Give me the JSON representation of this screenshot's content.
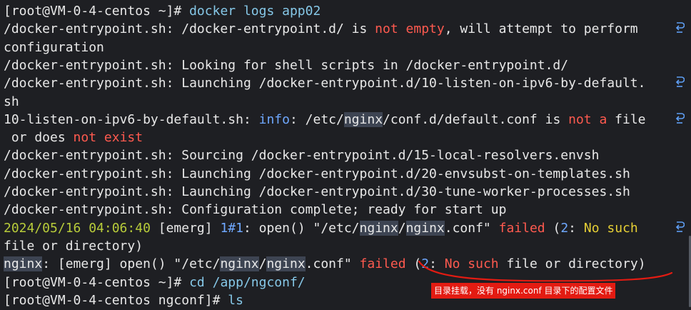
{
  "colors": {
    "background": "#1e1f23",
    "default": "#e8e8e8",
    "prompt_path": "#86c8e8",
    "command": "#6fa8ff",
    "error": "#ff5a4f",
    "timestamp": "#b8cc3a",
    "highlight_word": "#e6cf35",
    "annotation": "#e31b12"
  },
  "terminal": {
    "lines": [
      {
        "wrap": false,
        "segments": [
          {
            "t": "[root@VM-0-4-centos ~]# ",
            "c": "default"
          },
          {
            "t": "docker logs app02",
            "c": "cyan"
          }
        ]
      },
      {
        "wrap": true,
        "segments": [
          {
            "t": "/docker-entrypoint.sh: /docker-entrypoint.d/ is ",
            "c": "default"
          },
          {
            "t": "not empty",
            "c": "red"
          },
          {
            "t": ", will attempt to perform",
            "c": "default"
          }
        ]
      },
      {
        "wrap": false,
        "segments": [
          {
            "t": "configuration",
            "c": "default"
          }
        ]
      },
      {
        "wrap": false,
        "segments": [
          {
            "t": "/docker-entrypoint.sh: Looking for shell scripts in /docker-entrypoint.d/",
            "c": "default"
          }
        ]
      },
      {
        "wrap": true,
        "segments": [
          {
            "t": "/docker-entrypoint.sh: Launching /docker-entrypoint.d/10-listen-on-ipv6-by-default.",
            "c": "default"
          }
        ]
      },
      {
        "wrap": false,
        "segments": [
          {
            "t": "sh",
            "c": "default"
          }
        ]
      },
      {
        "wrap": true,
        "segments": [
          {
            "t": "10-listen-on-ipv6-by-default.sh: ",
            "c": "default"
          },
          {
            "t": "info",
            "c": "blue"
          },
          {
            "t": ": /etc/",
            "c": "default"
          },
          {
            "t": "nginx",
            "c": "default",
            "hl": true
          },
          {
            "t": "/conf.d/default.conf is ",
            "c": "default"
          },
          {
            "t": "not a",
            "c": "red"
          },
          {
            "t": " file",
            "c": "default"
          }
        ]
      },
      {
        "wrap": false,
        "segments": [
          {
            "t": " or does ",
            "c": "default"
          },
          {
            "t": "not exist",
            "c": "red"
          }
        ]
      },
      {
        "wrap": false,
        "segments": [
          {
            "t": "/docker-entrypoint.sh: Sourcing /docker-entrypoint.d/15-local-resolvers.envsh",
            "c": "default"
          }
        ]
      },
      {
        "wrap": false,
        "segments": [
          {
            "t": "/docker-entrypoint.sh: Launching /docker-entrypoint.d/20-envsubst-on-templates.sh",
            "c": "default"
          }
        ]
      },
      {
        "wrap": false,
        "segments": [
          {
            "t": "/docker-entrypoint.sh: Launching /docker-entrypoint.d/30-tune-worker-processes.sh",
            "c": "default"
          }
        ]
      },
      {
        "wrap": false,
        "segments": [
          {
            "t": "/docker-entrypoint.sh: Configuration complete; ready for start up",
            "c": "default"
          }
        ]
      },
      {
        "wrap": true,
        "segments": [
          {
            "t": "2024/05/16 04:06:40 ",
            "c": "green"
          },
          {
            "t": "[emerg] ",
            "c": "default"
          },
          {
            "t": "1#1",
            "c": "blue"
          },
          {
            "t": ": open() \"/etc/",
            "c": "default"
          },
          {
            "t": "nginx",
            "c": "default",
            "hl": true
          },
          {
            "t": "/",
            "c": "default"
          },
          {
            "t": "nginx",
            "c": "default",
            "hl": true
          },
          {
            "t": ".conf\" ",
            "c": "default"
          },
          {
            "t": "failed",
            "c": "red"
          },
          {
            "t": " (",
            "c": "default"
          },
          {
            "t": "2",
            "c": "blue"
          },
          {
            "t": ": ",
            "c": "default"
          },
          {
            "t": "No such",
            "c": "yellow"
          }
        ]
      },
      {
        "wrap": false,
        "segments": [
          {
            "t": "file or directory)",
            "c": "default"
          }
        ]
      },
      {
        "wrap": false,
        "segments": [
          {
            "t": "nginx",
            "c": "default",
            "hl": true
          },
          {
            "t": ": [emerg] open() \"/etc/",
            "c": "default"
          },
          {
            "t": "nginx",
            "c": "default",
            "hl": true
          },
          {
            "t": "/",
            "c": "default"
          },
          {
            "t": "nginx",
            "c": "default",
            "hl": true
          },
          {
            "t": ".conf\" ",
            "c": "default"
          },
          {
            "t": "failed",
            "c": "red"
          },
          {
            "t": " (",
            "c": "default"
          },
          {
            "t": "2",
            "c": "blue"
          },
          {
            "t": ": ",
            "c": "default"
          },
          {
            "t": "No such",
            "c": "red"
          },
          {
            "t": " file or directory)",
            "c": "default"
          }
        ]
      },
      {
        "wrap": false,
        "segments": [
          {
            "t": "[root@VM-0-4-centos ~]# ",
            "c": "default"
          },
          {
            "t": "cd /app/ngconf/",
            "c": "cyan"
          }
        ]
      },
      {
        "wrap": false,
        "segments": [
          {
            "t": "[root@VM-0-4-centos ngconf]# ",
            "c": "default"
          },
          {
            "t": "ls",
            "c": "cyan"
          }
        ]
      }
    ]
  },
  "annotation": {
    "text": "目录挂载，没有 nginx.conf 目录下的配置文件"
  },
  "icons": {
    "wrap": "line-wrap-icon"
  }
}
